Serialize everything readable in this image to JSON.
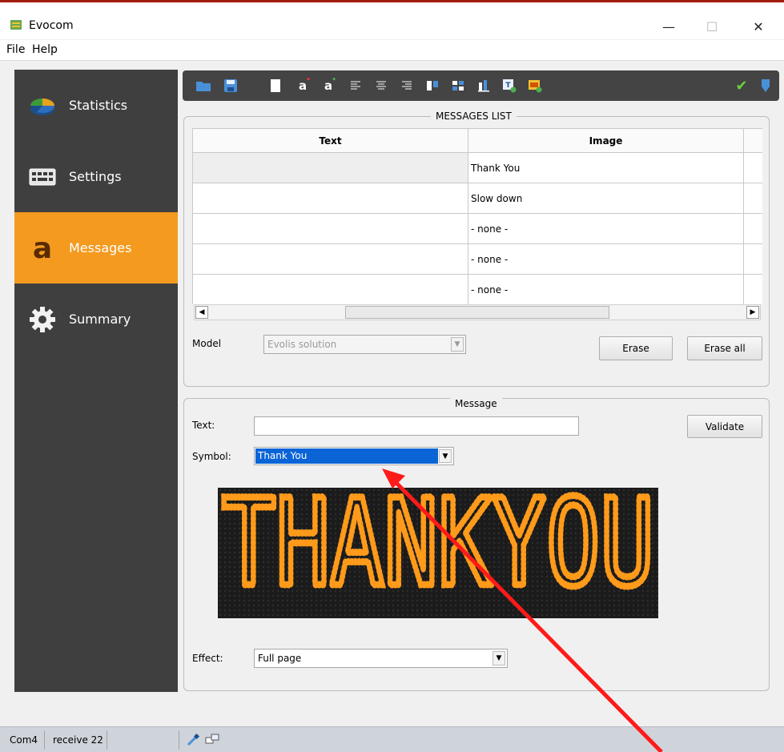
{
  "window": {
    "title": "Evocom",
    "accent_color": "#f39a1f",
    "controls": {
      "minimize": "—",
      "maximize": "☐",
      "close": "✕"
    }
  },
  "menubar": {
    "items": [
      "File",
      "Help"
    ]
  },
  "sidebar": {
    "items": [
      {
        "label": "Statistics",
        "icon": "pie-chart-icon",
        "active": false
      },
      {
        "label": "Settings",
        "icon": "keyboard-icon",
        "active": false
      },
      {
        "label": "Messages",
        "icon": "letter-a-icon",
        "active": true
      },
      {
        "label": "Summary",
        "icon": "gear-icon",
        "active": false
      }
    ]
  },
  "toolbar": {
    "left_icons": [
      "open-folder-icon",
      "save-icon",
      "blank-page-icon",
      "font-red-icon",
      "font-green-icon",
      "align-left-icon",
      "align-center-icon",
      "align-right-icon",
      "layout-split-icon",
      "layout-grid-icon",
      "layout-bars-icon",
      "insert-text-icon",
      "insert-image-icon"
    ],
    "right_icons": [
      "checkmark-icon",
      "send-icon"
    ]
  },
  "messages_list": {
    "title": "MESSAGES LIST",
    "columns": [
      "Text",
      "Image"
    ],
    "rows": [
      {
        "text": "",
        "image": "Thank You"
      },
      {
        "text": "",
        "image": "Slow down"
      },
      {
        "text": "",
        "image": "- none -"
      },
      {
        "text": "",
        "image": "- none -"
      },
      {
        "text": "",
        "image": "- none -"
      }
    ],
    "model_label": "Model",
    "model_value": "Evolis solution",
    "erase_label": "Erase",
    "erase_all_label": "Erase all"
  },
  "message": {
    "title": "Message",
    "text_label": "Text:",
    "text_value": "",
    "validate_label": "Validate",
    "symbol_label": "Symbol:",
    "symbol_value": "Thank You",
    "preview_text": "THANKYOU",
    "preview_color": "#ff9a1a",
    "effect_label": "Effect:",
    "effect_value": "Full page"
  },
  "statusbar": {
    "port": "Com4",
    "receive": "receive 22"
  }
}
